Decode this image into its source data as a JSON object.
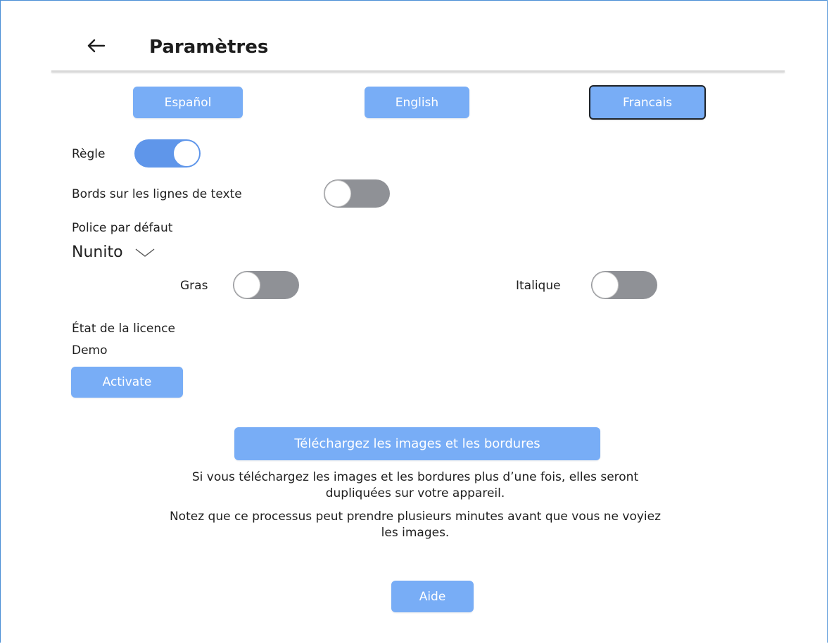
{
  "header": {
    "title": "Paramètres",
    "back_icon": "arrow-left-icon"
  },
  "languages": [
    {
      "label": "Español",
      "selected": false
    },
    {
      "label": "English",
      "selected": false
    },
    {
      "label": "Francais",
      "selected": true
    }
  ],
  "settings": {
    "ruler": {
      "label": "Règle",
      "enabled": true
    },
    "borders_on_text_lines": {
      "label": "Bords sur les lignes de texte",
      "enabled": false
    },
    "default_font": {
      "label": "Police par défaut",
      "value": "Nunito",
      "icon": "chevron-down-icon"
    },
    "bold": {
      "label": "Gras",
      "enabled": false
    },
    "italic": {
      "label": "Italique",
      "enabled": false
    }
  },
  "license": {
    "label": "État de la licence",
    "status": "Demo",
    "activate_label": "Activate"
  },
  "download": {
    "button_label": "Téléchargez les images et les bordures",
    "warning_line1": "Si vous téléchargez les images et les bordures plus d’une fois, elles seront",
    "warning_line2": "dupliquées sur votre appareil.",
    "note_line1": "Notez que ce processus peut prendre plusieurs minutes avant que vous ne voyiez",
    "note_line2": "les images."
  },
  "help": {
    "label": "Aide"
  },
  "colors": {
    "accent": "#78adf6",
    "toggle_on": "#5f96ea",
    "toggle_off": "#8f9196",
    "frame": "#4a8fd6"
  }
}
